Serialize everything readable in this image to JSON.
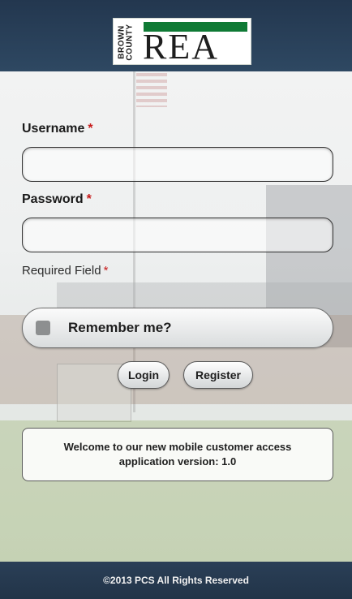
{
  "header": {
    "logo": {
      "vertical_text_top": "BROWN",
      "vertical_text_bottom": "COUNTY",
      "main_text": "REA",
      "bar_color": "#0f7a35"
    }
  },
  "form": {
    "username": {
      "label": "Username",
      "required_mark": "*",
      "value": "",
      "placeholder": ""
    },
    "password": {
      "label": "Password",
      "required_mark": "*",
      "value": "",
      "placeholder": ""
    },
    "required_note": {
      "text": "Required Field",
      "mark": "*"
    },
    "remember": {
      "label": "Remember me?",
      "checked": false
    },
    "buttons": {
      "login": "Login",
      "register": "Register"
    }
  },
  "notice": {
    "text": "Welcome to our new mobile customer access application version: 1.0"
  },
  "footer": {
    "text": "©2013 PCS All Rights Reserved"
  },
  "colors": {
    "header_bg": "#2a3f57",
    "required_star": "#c71a1a"
  }
}
